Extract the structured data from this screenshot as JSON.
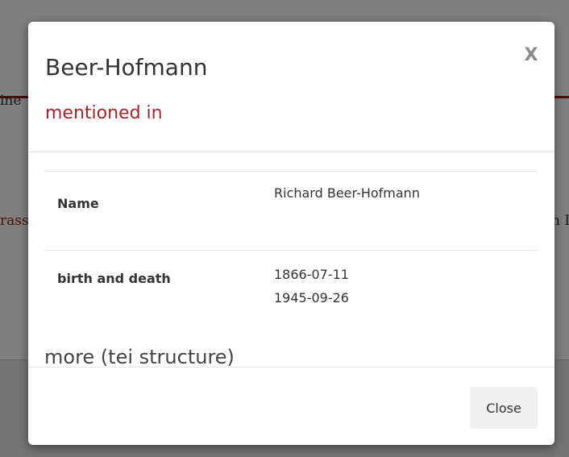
{
  "background": {
    "fragment_left": "ine",
    "fragment_link": "rass",
    "fragment_right": "n I"
  },
  "modal": {
    "title": "Beer-Hofmann",
    "subtitle": "mentioned in",
    "close_icon": "X",
    "table": {
      "name_label": "Name",
      "name_value": "Richard Beer-Hofmann",
      "birth_death_label": "birth and death",
      "birth": "1866-07-11",
      "death": "1945-09-26"
    },
    "more_link": "more (tei structure)",
    "close_button": "Close"
  },
  "colors": {
    "subtitle": "#a4262c",
    "backdrop": "rgba(0,0,0,0.5)"
  }
}
